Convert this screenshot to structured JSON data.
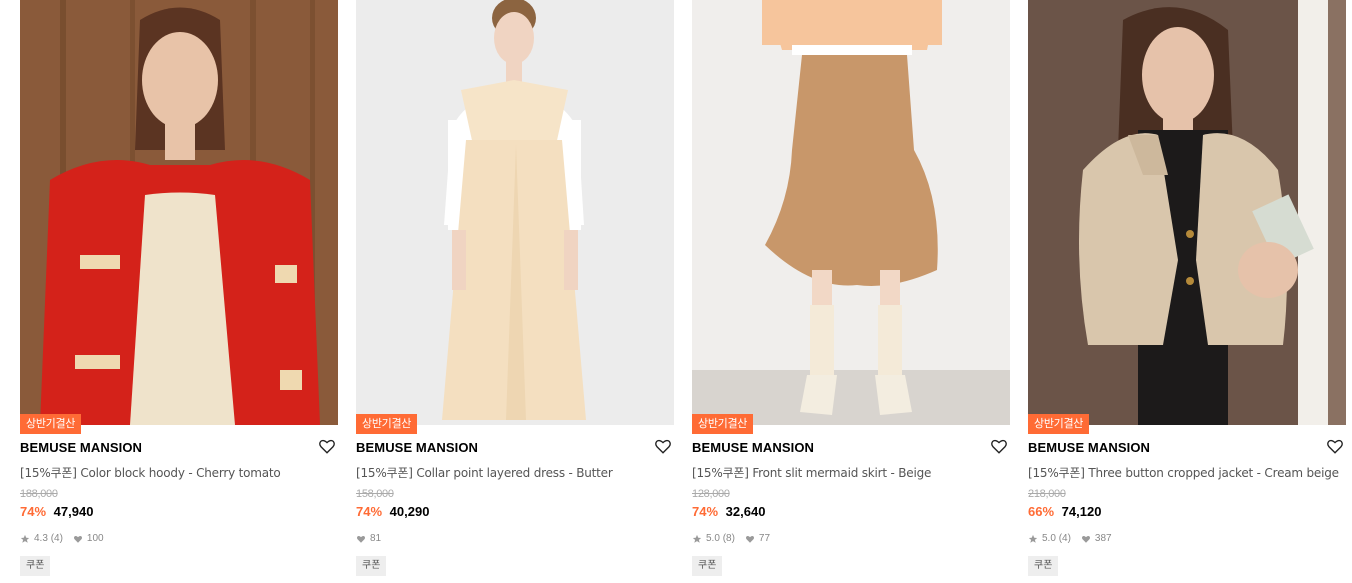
{
  "products": [
    {
      "badge": "상반기결산",
      "brand": "BEMUSE MANSION",
      "name": "[15%쿠폰] Color block hoody - Cherry tomato",
      "original_price": "188,000",
      "discount": "74%",
      "price": "47,940",
      "rating": "4.3",
      "reviews": "(4)",
      "likes": "100",
      "coupon": "쿠폰",
      "image": {
        "bg": "#8a5a3a",
        "garment": "#d4221a",
        "skin": "#e8c3a8",
        "hair": "#5b3422",
        "top": "#efe3cb"
      }
    },
    {
      "badge": "상반기결산",
      "brand": "BEMUSE MANSION",
      "name": "[15%쿠폰] Collar point layered dress - Butter",
      "original_price": "158,000",
      "discount": "74%",
      "price": "40,290",
      "rating": "",
      "reviews": "",
      "likes": "81",
      "coupon": "쿠폰",
      "image": {
        "bg": "#ececec",
        "garment": "#f4dfc0",
        "skin": "#f0d4c2",
        "hair": "#8c6440",
        "top": "#ffffff"
      }
    },
    {
      "badge": "상반기결산",
      "brand": "BEMUSE MANSION",
      "name": "[15%쿠폰] Front slit mermaid skirt - Beige",
      "original_price": "128,000",
      "discount": "74%",
      "price": "32,640",
      "rating": "5.0",
      "reviews": "(8)",
      "likes": "77",
      "coupon": "쿠폰",
      "image": {
        "bg": "#f0eeec",
        "garment": "#c8976a",
        "skin": "#f2d8c6",
        "hair": "#000000",
        "top": "#f6c59c"
      }
    },
    {
      "badge": "상반기결산",
      "brand": "BEMUSE MANSION",
      "name": "[15%쿠폰] Three button cropped jacket - Cream beige",
      "original_price": "218,000",
      "discount": "66%",
      "price": "74,120",
      "rating": "5.0",
      "reviews": "(4)",
      "likes": "387",
      "coupon": "쿠폰",
      "image": {
        "bg": "#6b5448",
        "garment": "#d9c6ac",
        "skin": "#e6c2aa",
        "hair": "#4a2f22",
        "top": "#1c1a1a"
      }
    }
  ],
  "colors": {
    "accent": "#ff6b35",
    "text": "#000000",
    "muted": "#888888"
  },
  "icons": {
    "like": "heart-outline-icon",
    "star": "star-icon",
    "heart": "heart-filled-icon"
  }
}
